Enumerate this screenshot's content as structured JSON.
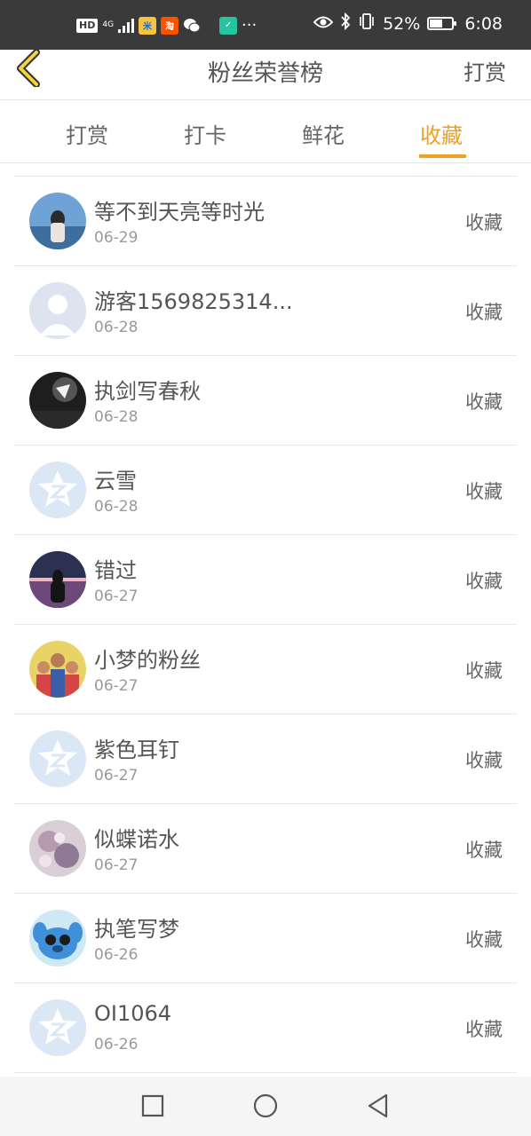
{
  "status_bar": {
    "hd": "HD",
    "network": "4G",
    "battery": "52%",
    "time": "6:08",
    "dots": "···",
    "battery_level": 0.52
  },
  "header": {
    "title": "粉丝荣誉榜",
    "action": "打赏"
  },
  "tabs": [
    {
      "label": "打赏",
      "active": false
    },
    {
      "label": "打卡",
      "active": false
    },
    {
      "label": "鲜花",
      "active": false
    },
    {
      "label": "收藏",
      "active": true
    }
  ],
  "list": [
    {
      "name": "等不到天亮等时光",
      "date": "06-29",
      "action": "收藏",
      "avatar": "photo-sky"
    },
    {
      "name": "游客1569825314...",
      "date": "06-28",
      "action": "收藏",
      "avatar": "default-person"
    },
    {
      "name": "执剑写春秋",
      "date": "06-28",
      "action": "收藏",
      "avatar": "photo-dark"
    },
    {
      "name": "云雪",
      "date": "06-28",
      "action": "收藏",
      "avatar": "qzone-default"
    },
    {
      "name": "错过",
      "date": "06-27",
      "action": "收藏",
      "avatar": "photo-sunset"
    },
    {
      "name": "小梦的粉丝",
      "date": "06-27",
      "action": "收藏",
      "avatar": "photo-family"
    },
    {
      "name": "紫色耳钉",
      "date": "06-27",
      "action": "收藏",
      "avatar": "qzone-default"
    },
    {
      "name": "似蝶诺水",
      "date": "06-27",
      "action": "收藏",
      "avatar": "photo-anime"
    },
    {
      "name": "执笔写梦",
      "date": "06-26",
      "action": "收藏",
      "avatar": "stitch-cartoon"
    },
    {
      "name": "OI1064",
      "date": "06-26",
      "action": "收藏",
      "avatar": "qzone-default"
    }
  ],
  "colors": {
    "accent": "#f0a020",
    "status_bar": "#3a3a3a"
  }
}
